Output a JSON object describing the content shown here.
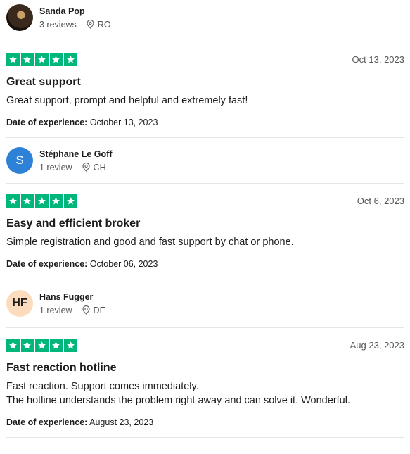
{
  "reviews": [
    {
      "reviewer": {
        "name": "Sanda Pop",
        "reviews": "3 reviews",
        "country": "RO",
        "avatar_type": "photo"
      },
      "rating": 5,
      "date": "Oct 13, 2023",
      "title": "Great support",
      "body_lines": [
        "Great support, prompt and helpful and extremely fast!"
      ],
      "experience_label": "Date of experience:",
      "experience_date": "October 13, 2023"
    },
    {
      "reviewer": {
        "name": "Stéphane Le Goff",
        "reviews": "1 review",
        "country": "CH",
        "initials": "S",
        "avatar_color": "#2d82d8"
      },
      "rating": 5,
      "date": "Oct 6, 2023",
      "title": "Easy and efficient broker",
      "body_lines": [
        "Simple registration and good and fast support by chat or phone."
      ],
      "experience_label": "Date of experience:",
      "experience_date": "October 06, 2023"
    },
    {
      "reviewer": {
        "name": "Hans Fugger",
        "reviews": "1 review",
        "country": "DE",
        "initials": "HF",
        "avatar_color": "#fcdcbd"
      },
      "rating": 5,
      "date": "Aug 23, 2023",
      "title": "Fast reaction hotline",
      "body_lines": [
        "Fast reaction. Support comes immediately.",
        "The hotline understands the problem right away and can solve it. Wonderful."
      ],
      "experience_label": "Date of experience:",
      "experience_date": "August 23, 2023"
    }
  ],
  "colors": {
    "star_green": "#00b67a",
    "divider": "#e5e5e5"
  },
  "icons": {
    "star": "star-icon",
    "location": "location-pin-icon"
  }
}
